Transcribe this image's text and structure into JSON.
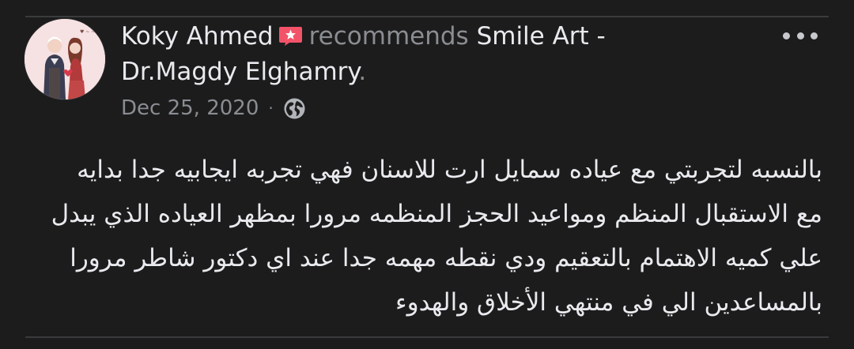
{
  "post": {
    "author": "Koky Ahmed",
    "verb": "recommends",
    "page_line1": "Smile Art -",
    "page_line2": "Dr.Magdy Elghamry",
    "page_suffix": ".",
    "date": "Dec 25, 2020",
    "separator": "·",
    "privacy_icon": "globe-icon",
    "recommend_icon": "recommendation-badge-icon",
    "more_icon": "more-options-icon",
    "body_lines": [
      "بالنسبه لتجربتي مع عياده سمايل ارت للاسنان فهي تجربه ايجابيه جدا بدايه",
      "مع الاستقبال المنظم ومواعيد الحجز المنظمه مرورا بمظهر العياده الذي يبدل",
      "علي كميه الاهتمام بالتعقيم ودي نقطه مهمه جدا عند اي دكتور شاطر  مرورا",
      "بالمساعدين الي في منتهي الأخلاق والهدوء"
    ]
  },
  "colors": {
    "background": "#1c1c1d",
    "primary_text": "#e9eaee",
    "secondary_text": "#8a8d91",
    "badge": "#f35369",
    "divider": "#3a3b3d"
  }
}
